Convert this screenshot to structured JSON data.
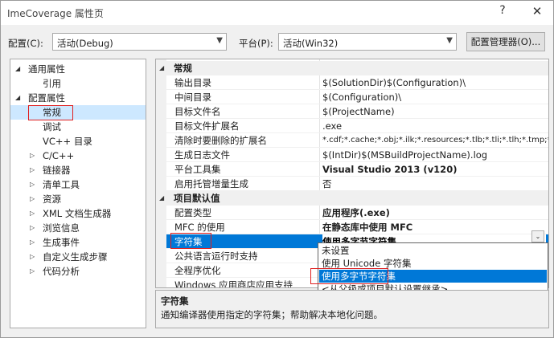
{
  "window": {
    "title": "ImeCoverage 属性页",
    "help": "?",
    "close": "✕"
  },
  "config_row": {
    "config_label": "配置(C):",
    "config_value": "活动(Debug)",
    "platform_label": "平台(P):",
    "platform_value": "活动(Win32)",
    "manager_button": "配置管理器(O)..."
  },
  "tree": {
    "items": [
      {
        "label": "通用属性",
        "toggle": "◢"
      },
      {
        "label": "引用"
      },
      {
        "label": "配置属性",
        "toggle": "◢"
      },
      {
        "label": "常规"
      },
      {
        "label": "调试"
      },
      {
        "label": "VC++ 目录"
      },
      {
        "label": "C/C++",
        "toggle": "▷"
      },
      {
        "label": "链接器",
        "toggle": "▷"
      },
      {
        "label": "清单工具",
        "toggle": "▷"
      },
      {
        "label": "资源",
        "toggle": "▷"
      },
      {
        "label": "XML 文档生成器",
        "toggle": "▷"
      },
      {
        "label": "浏览信息",
        "toggle": "▷"
      },
      {
        "label": "生成事件",
        "toggle": "▷"
      },
      {
        "label": "自定义生成步骤",
        "toggle": "▷"
      },
      {
        "label": "代码分析",
        "toggle": "▷"
      }
    ]
  },
  "grid": {
    "categories": [
      {
        "label": "常规",
        "toggle": "◢"
      },
      {
        "label": "项目默认值",
        "toggle": "◢"
      }
    ],
    "rows": [
      {
        "name": "输出目录",
        "value": "$(SolutionDir)$(Configuration)\\"
      },
      {
        "name": "中间目录",
        "value": "$(Configuration)\\"
      },
      {
        "name": "目标文件名",
        "value": "$(ProjectName)"
      },
      {
        "name": "目标文件扩展名",
        "value": ".exe"
      },
      {
        "name": "清除时要删除的扩展名",
        "value": "*.cdf;*.cache;*.obj;*.ilk;*.resources;*.tlb;*.tli;*.tlh;*.tmp;*"
      },
      {
        "name": "生成日志文件",
        "value": "$(IntDir)$(MSBuildProjectName).log"
      },
      {
        "name": "平台工具集",
        "value": "Visual Studio 2013 (v120)"
      },
      {
        "name": "启用托管增量生成",
        "value": "否"
      },
      {
        "name": "配置类型",
        "value": "应用程序(.exe)"
      },
      {
        "name": "MFC 的使用",
        "value": "在静态库中使用 MFC"
      },
      {
        "name": "字符集",
        "value": "使用多字节字符集"
      },
      {
        "name": "公共语言运行时支持",
        "value": ""
      },
      {
        "name": "全程序优化",
        "value": ""
      },
      {
        "name": "Windows 应用商店应用支持",
        "value": ""
      }
    ],
    "dropdown_arrow": "⌄"
  },
  "dropdown": {
    "options": [
      "未设置",
      "使用 Unicode 字符集",
      "使用多字节字符集",
      "<从父级或项目默认设置继承>"
    ]
  },
  "description": {
    "title": "字符集",
    "text": "通知编译器使用指定的字符集；帮助解决本地化问题。"
  },
  "colors": {
    "selection": "#0078d7",
    "annotation_box": "#e02020",
    "tree_selection": "#cde8ff"
  }
}
